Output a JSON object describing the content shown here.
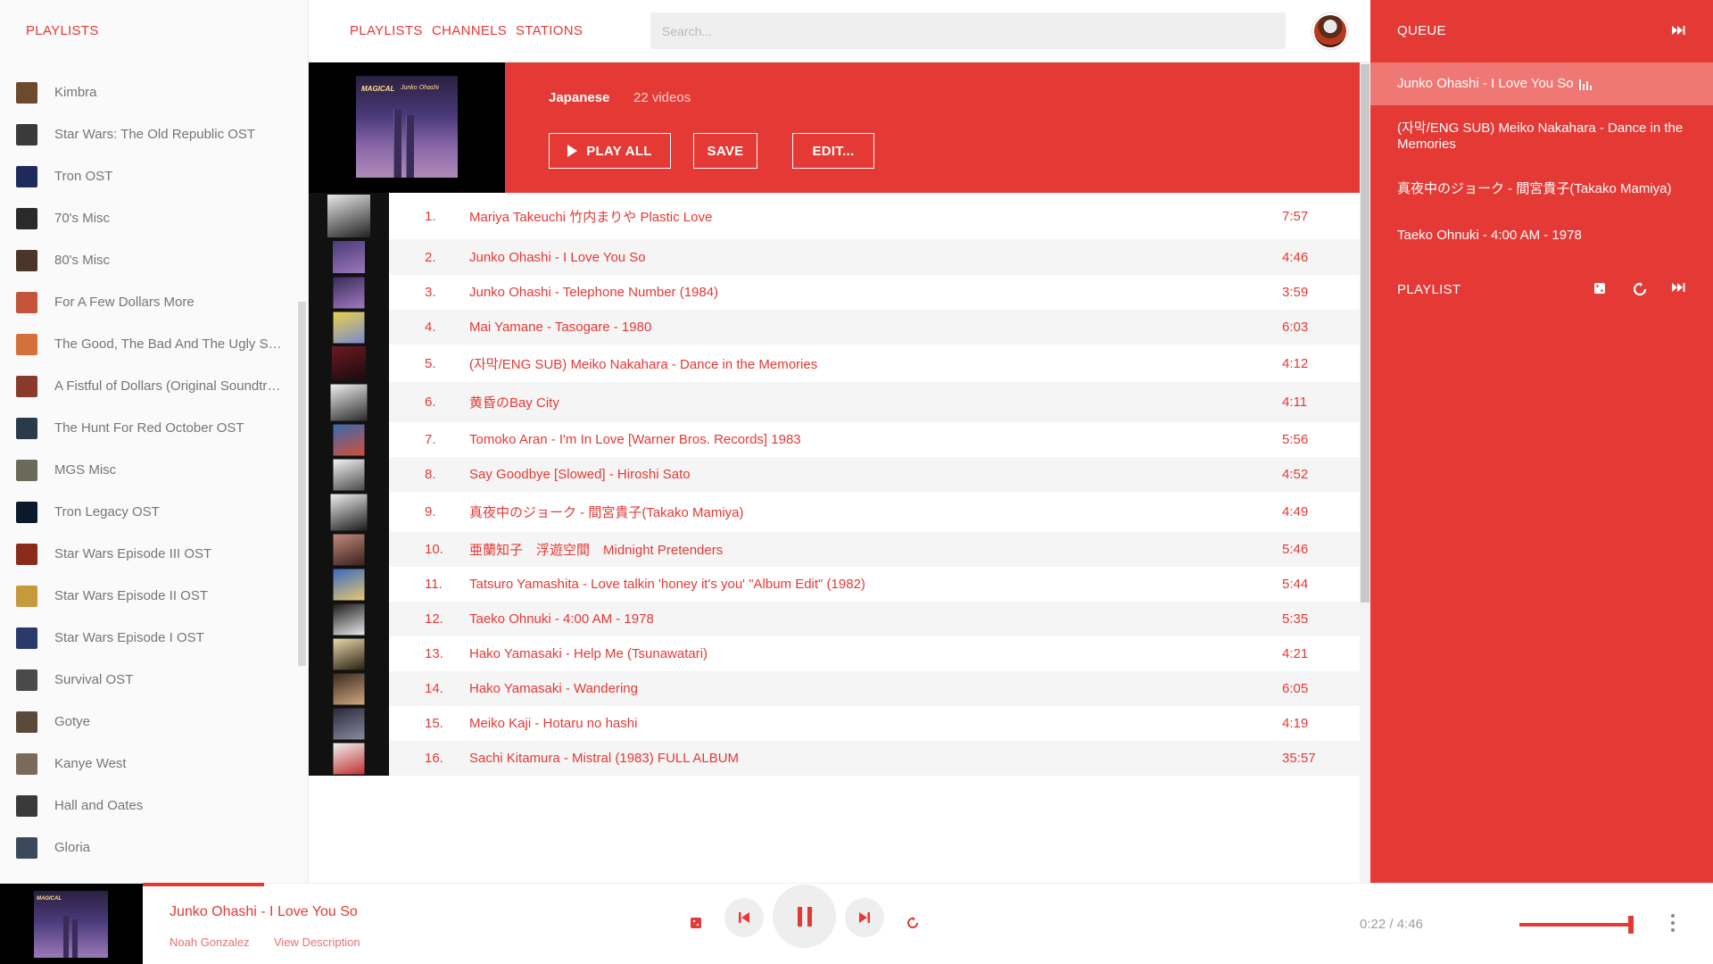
{
  "colors": {
    "accent": "#e53935",
    "accent_light": "#ef7774",
    "muted_text": "#757575"
  },
  "sidebar": {
    "title": "PLAYLISTS",
    "items": [
      {
        "label": "Kimbra",
        "thumb": "#6b4a2e"
      },
      {
        "label": "Star Wars: The Old Republic OST",
        "thumb": "#3a3a3a"
      },
      {
        "label": "Tron OST",
        "thumb": "#1d2a5a"
      },
      {
        "label": "70's Misc",
        "thumb": "#2a2a2a"
      },
      {
        "label": "80's Misc",
        "thumb": "#4a3528"
      },
      {
        "label": "For A Few Dollars More",
        "thumb": "#c4553a"
      },
      {
        "label": "The Good, The Bad And The Ugly Soundtrack",
        "thumb": "#d4703a"
      },
      {
        "label": "A Fistful of Dollars (Original Soundtrack)",
        "thumb": "#8a3a2a"
      },
      {
        "label": "The Hunt For Red October OST",
        "thumb": "#2a3a4a"
      },
      {
        "label": "MGS Misc",
        "thumb": "#6a6a5a"
      },
      {
        "label": "Tron Legacy OST",
        "thumb": "#0a1a2a"
      },
      {
        "label": "Star Wars Episode III OST",
        "thumb": "#8a2a1a"
      },
      {
        "label": "Star Wars Episode II OST",
        "thumb": "#c49a3a"
      },
      {
        "label": "Star Wars Episode I OST",
        "thumb": "#2a3a6a"
      },
      {
        "label": "Survival OST",
        "thumb": "#4a4a4a"
      },
      {
        "label": "Gotye",
        "thumb": "#5a4a3a"
      },
      {
        "label": "Kanye West",
        "thumb": "#7a6a5a"
      },
      {
        "label": "Hall and Oates",
        "thumb": "#3a3a3a"
      },
      {
        "label": "Gloria",
        "thumb": "#3a4a5a"
      }
    ]
  },
  "topbar": {
    "tabs": [
      "PLAYLISTS",
      "CHANNELS",
      "STATIONS"
    ],
    "search_placeholder": "Search..."
  },
  "playlist": {
    "name": "Japanese",
    "count": "22 videos",
    "cover_text_1": "MAGICAL",
    "cover_text_2": "Junko Ohashi",
    "buttons": {
      "play_all": "PLAY ALL",
      "save": "SAVE",
      "edit": "EDIT..."
    },
    "tracks": [
      {
        "num": "1.",
        "title": "Mariya Takeuchi 竹内まりや Plastic Love",
        "dur": "7:57",
        "h": 52,
        "c1": "#e8e8e8",
        "c2": "#222222"
      },
      {
        "num": "2.",
        "title": "Junko Ohashi - I Love You So",
        "dur": "4:46",
        "h": 40,
        "c1": "#4a3a7a",
        "c2": "#9a78b8"
      },
      {
        "num": "3.",
        "title": "Junko Ohashi - Telephone Number (1984)",
        "dur": "3:59",
        "h": 39,
        "c1": "#3a2c58",
        "c2": "#a07ac0"
      },
      {
        "num": "4.",
        "title": "Mai Yamane - Tasogare - 1980",
        "dur": "6:03",
        "h": 39,
        "c1": "#e8d24a",
        "c2": "#7a8ad0"
      },
      {
        "num": "5.",
        "title": "(자막/ENG SUB) Meiko Nakahara - Dance in the Memories",
        "dur": "4:12",
        "h": 42,
        "c1": "#6a1a20",
        "c2": "#1a0a10"
      },
      {
        "num": "6.",
        "title": "黄昏のBay City",
        "dur": "4:11",
        "h": 45,
        "c1": "#f0f0f0",
        "c2": "#2a2a2a"
      },
      {
        "num": "7.",
        "title": "Tomoko Aran - I'm In Love [Warner Bros. Records] 1983",
        "dur": "5:56",
        "h": 39,
        "c1": "#3a6ab0",
        "c2": "#d0503a"
      },
      {
        "num": "8.",
        "title": "Say Goodbye [Slowed] - Hiroshi Sato",
        "dur": "4:52",
        "h": 39,
        "c1": "#f4f4f4",
        "c2": "#4a4a4a"
      },
      {
        "num": "9.",
        "title": "真夜中のジョーク - 間宮貴子(Takako Mamiya)",
        "dur": "4:49",
        "h": 45,
        "c1": "#f0f0f0",
        "c2": "#1a1a1a"
      },
      {
        "num": "10.",
        "title": "亜蘭知子　浮遊空間　Midnight Pretenders",
        "dur": "5:46",
        "h": 39,
        "c1": "#c08a7a",
        "c2": "#3a2020"
      },
      {
        "num": "11.",
        "title": "Tatsuro Yamashita - Love talkin 'honey it's you' \"Album Edit\" (1982)",
        "dur": "5:44",
        "h": 39,
        "c1": "#3a6ac0",
        "c2": "#e8c870"
      },
      {
        "num": "12.",
        "title": "Taeko Ohnuki - 4:00 AM - 1978",
        "dur": "5:35",
        "h": 39,
        "c1": "#1a1a1a",
        "c2": "#e8e8e8"
      },
      {
        "num": "13.",
        "title": "Hako Yamasaki - Help Me (Tsunawatari)",
        "dur": "4:21",
        "h": 39,
        "c1": "#e8d8b0",
        "c2": "#2a2010"
      },
      {
        "num": "14.",
        "title": "Hako Yamasaki - Wandering",
        "dur": "6:05",
        "h": 39,
        "c1": "#3a2a20",
        "c2": "#d0a880"
      },
      {
        "num": "15.",
        "title": "Meiko Kaji - Hotaru no hashi",
        "dur": "4:19",
        "h": 39,
        "c1": "#2a2a3a",
        "c2": "#8a8aa0"
      },
      {
        "num": "16.",
        "title": "Sachi Kitamura - Mistral (1983) FULL ALBUM",
        "dur": "35:57",
        "h": 39,
        "c1": "#f0f0f0",
        "c2": "#c03030"
      }
    ]
  },
  "queue": {
    "title": "QUEUE",
    "items": [
      "Junko Ohashi - I Love You So",
      "(자막/ENG SUB) Meiko Nakahara - Dance in the Memories",
      "真夜中のジョーク - 間宮貴子(Takako Mamiya)",
      "Taeko Ohnuki - 4:00 AM - 1978"
    ],
    "playlist_label": "PLAYLIST"
  },
  "player": {
    "title": "Junko Ohashi - I Love You So",
    "artist": "Noah Gonzalez",
    "description_link": "View Description",
    "time": "0:22 / 4:46",
    "progress_fraction": 0.077,
    "volume_fraction": 0.97
  }
}
